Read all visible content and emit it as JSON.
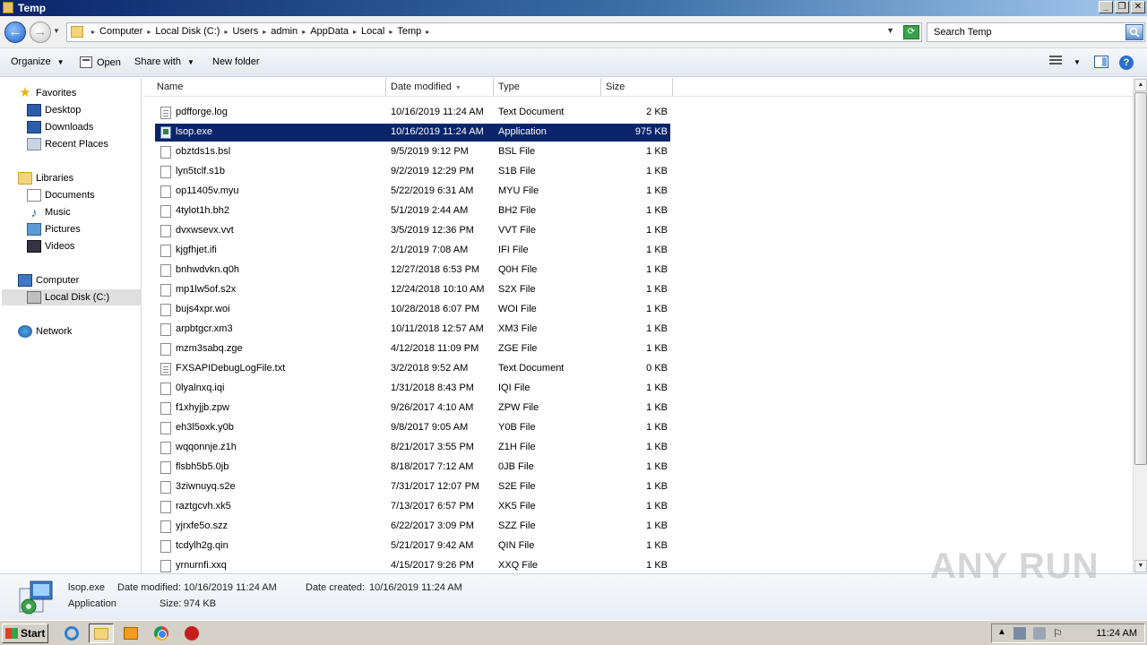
{
  "window": {
    "title": "Temp"
  },
  "address": {
    "breadcrumbs": [
      "Computer",
      "Local Disk (C:)",
      "Users",
      "admin",
      "AppData",
      "Local",
      "Temp"
    ]
  },
  "search": {
    "placeholder": "Search Temp"
  },
  "toolbar": {
    "organize": "Organize",
    "open": "Open",
    "share_with": "Share with",
    "new_folder": "New folder"
  },
  "nav": {
    "favorites": "Favorites",
    "desktop": "Desktop",
    "downloads": "Downloads",
    "recent_places": "Recent Places",
    "libraries": "Libraries",
    "documents": "Documents",
    "music": "Music",
    "pictures": "Pictures",
    "videos": "Videos",
    "computer": "Computer",
    "local_disk": "Local Disk (C:)",
    "network": "Network"
  },
  "columns": {
    "name": "Name",
    "date_modified": "Date modified",
    "type": "Type",
    "size": "Size"
  },
  "files": [
    {
      "name": "pdfforge.log",
      "date": "10/16/2019 11:24 AM",
      "type": "Text Document",
      "size": "2 KB"
    },
    {
      "name": "lsop.exe",
      "date": "10/16/2019 11:24 AM",
      "type": "Application",
      "size": "975 KB"
    },
    {
      "name": "obztds1s.bsl",
      "date": "9/5/2019 9:12 PM",
      "type": "BSL File",
      "size": "1 KB"
    },
    {
      "name": "lyn5tclf.s1b",
      "date": "9/2/2019 12:29 PM",
      "type": "S1B File",
      "size": "1 KB"
    },
    {
      "name": "op11405v.myu",
      "date": "5/22/2019 6:31 AM",
      "type": "MYU File",
      "size": "1 KB"
    },
    {
      "name": "4tylot1h.bh2",
      "date": "5/1/2019 2:44 AM",
      "type": "BH2 File",
      "size": "1 KB"
    },
    {
      "name": "dvxwsevx.vvt",
      "date": "3/5/2019 12:36 PM",
      "type": "VVT File",
      "size": "1 KB"
    },
    {
      "name": "kjgfhjet.ifi",
      "date": "2/1/2019 7:08 AM",
      "type": "IFI File",
      "size": "1 KB"
    },
    {
      "name": "bnhwdvkn.q0h",
      "date": "12/27/2018 6:53 PM",
      "type": "Q0H File",
      "size": "1 KB"
    },
    {
      "name": "mp1lw5of.s2x",
      "date": "12/24/2018 10:10 AM",
      "type": "S2X File",
      "size": "1 KB"
    },
    {
      "name": "bujs4xpr.woi",
      "date": "10/28/2018 6:07 PM",
      "type": "WOI File",
      "size": "1 KB"
    },
    {
      "name": "arpbtgcr.xm3",
      "date": "10/11/2018 12:57 AM",
      "type": "XM3 File",
      "size": "1 KB"
    },
    {
      "name": "mzm3sabq.zge",
      "date": "4/12/2018 11:09 PM",
      "type": "ZGE File",
      "size": "1 KB"
    },
    {
      "name": "FXSAPIDebugLogFile.txt",
      "date": "3/2/2018 9:52 AM",
      "type": "Text Document",
      "size": "0 KB"
    },
    {
      "name": "0lyalnxq.iqi",
      "date": "1/31/2018 8:43 PM",
      "type": "IQI File",
      "size": "1 KB"
    },
    {
      "name": "f1xhyjjb.zpw",
      "date": "9/26/2017 4:10 AM",
      "type": "ZPW File",
      "size": "1 KB"
    },
    {
      "name": "eh3l5oxk.y0b",
      "date": "9/8/2017 9:05 AM",
      "type": "Y0B File",
      "size": "1 KB"
    },
    {
      "name": "wqqonnje.z1h",
      "date": "8/21/2017 3:55 PM",
      "type": "Z1H File",
      "size": "1 KB"
    },
    {
      "name": "flsbh5b5.0jb",
      "date": "8/18/2017 7:12 AM",
      "type": "0JB File",
      "size": "1 KB"
    },
    {
      "name": "3ziwnuyq.s2e",
      "date": "7/31/2017 12:07 PM",
      "type": "S2E File",
      "size": "1 KB"
    },
    {
      "name": "raztgcvh.xk5",
      "date": "7/13/2017 6:57 PM",
      "type": "XK5 File",
      "size": "1 KB"
    },
    {
      "name": "yjrxfe5o.szz",
      "date": "6/22/2017 3:09 PM",
      "type": "SZZ File",
      "size": "1 KB"
    },
    {
      "name": "tcdylh2g.qin",
      "date": "5/21/2017 9:42 AM",
      "type": "QIN File",
      "size": "1 KB"
    },
    {
      "name": "yrnurnfi.xxq",
      "date": "4/15/2017 9:26 PM",
      "type": "XXQ File",
      "size": "1 KB"
    }
  ],
  "selected_index": 1,
  "details": {
    "name": "lsop.exe",
    "type": "Application",
    "date_modified_label": "Date modified:",
    "date_modified": "10/16/2019 11:24 AM",
    "date_created_label": "Date created:",
    "date_created": "10/16/2019 11:24 AM",
    "size_label": "Size:",
    "size": "974 KB"
  },
  "taskbar": {
    "start": "Start",
    "clock": "11:24 AM"
  },
  "watermark": "ANY RUN",
  "colors": {
    "selection": "#0a246a",
    "title_gradient_start": "#0a246a",
    "taskbar": "#d4d0c8"
  }
}
